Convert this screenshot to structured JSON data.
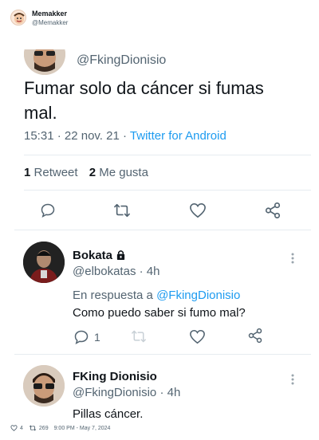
{
  "header": {
    "account_name": "Memakker",
    "account_handle": "@Memakker"
  },
  "main_tweet": {
    "handle": "@FkingDionisio",
    "text_line1": "Fumar solo da cáncer si fumas",
    "text_line2": "mal.",
    "time": "15:31",
    "date": "· 22 nov. 21 ·",
    "source": "Twitter for Android",
    "retweet_count": "1",
    "retweet_label": "Retweet",
    "like_count": "2",
    "like_label": "Me gusta"
  },
  "reply1": {
    "name": "Bokata",
    "handle": "@elbokatas",
    "time": "· 4h",
    "reply_prefix": "En respuesta a",
    "reply_to": "@FkingDionisio",
    "text": "Como puedo saber si fumo mal?",
    "reply_count": "1"
  },
  "reply2": {
    "name": "FKing Dionisio",
    "handle": "@FkingDionisio",
    "time": "· 4h",
    "text": "Pillas cáncer."
  },
  "footer": {
    "likes": "4",
    "retweets": "269",
    "timestamp": "9:00 PM - May 7, 2024"
  },
  "colors": {
    "accent": "#1d9bf0",
    "muted": "#536471",
    "text": "#0f1419",
    "divider": "#e6ecf0"
  }
}
